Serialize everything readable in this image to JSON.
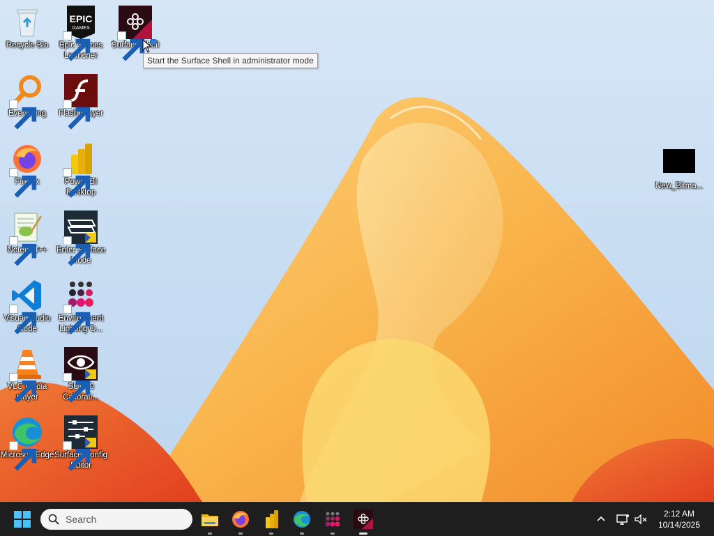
{
  "desktop": {
    "icons": [
      {
        "name": "recycle-bin-icon",
        "label": "Recycle Bin",
        "shortcut": false
      },
      {
        "name": "epic-games-launcher-icon",
        "label": "Epic Games Launcher",
        "shortcut": true
      },
      {
        "name": "surface-shell-icon",
        "label": "Surface Shell",
        "shortcut": true
      },
      {
        "name": "everything-icon",
        "label": "Everything",
        "shortcut": true
      },
      {
        "name": "flash-player-icon",
        "label": "Flash Player",
        "shortcut": true
      },
      {
        "name": "firefox-icon",
        "label": "Firefox",
        "shortcut": true
      },
      {
        "name": "power-bi-desktop-icon",
        "label": "Power BI Desktop",
        "shortcut": true
      },
      {
        "name": "notepad-plus-plus-icon",
        "label": "Notepad++",
        "shortcut": true
      },
      {
        "name": "enter-surface-mode-icon",
        "label": "Enter Surface Mode",
        "shortcut": true
      },
      {
        "name": "vscode-icon",
        "label": "Visual Studio Code",
        "shortcut": true
      },
      {
        "name": "environment-lighting-icon",
        "label": "Environment Lighting O...",
        "shortcut": true
      },
      {
        "name": "vlc-icon",
        "label": "VLC media player",
        "shortcut": true
      },
      {
        "name": "sur40-calibration-icon",
        "label": "SUR40 Calibrati...",
        "shortcut": true
      },
      {
        "name": "microsoft-edge-icon",
        "label": "Microsoft Edge",
        "shortcut": true
      },
      {
        "name": "surface-config-editor-icon",
        "label": "Surface Config Editor",
        "shortcut": true
      },
      {
        "name": "bitmap-file-icon",
        "label": "New_Bitma...",
        "shortcut": false
      }
    ],
    "tooltip": "Start the Surface Shell in administrator mode"
  },
  "taskbar": {
    "search_placeholder": "Search",
    "clock_time": "2:12 AM",
    "clock_date": "10/14/2025",
    "pinned": [
      {
        "name": "file-explorer-icon",
        "running": true
      },
      {
        "name": "firefox-icon",
        "running": true
      },
      {
        "name": "power-bi-icon",
        "running": true
      },
      {
        "name": "edge-icon",
        "running": true
      },
      {
        "name": "environment-lighting-icon",
        "running": true
      },
      {
        "name": "surface-shell-icon",
        "running": true,
        "active": true
      }
    ],
    "tray": [
      "chevron-up-icon",
      "network-icon",
      "volume-muted-icon"
    ]
  },
  "colors": {
    "taskbar": "#1e1e1f",
    "wallpaper_bg": "#cfe2f5",
    "accent_orange": "#f7a43a"
  }
}
